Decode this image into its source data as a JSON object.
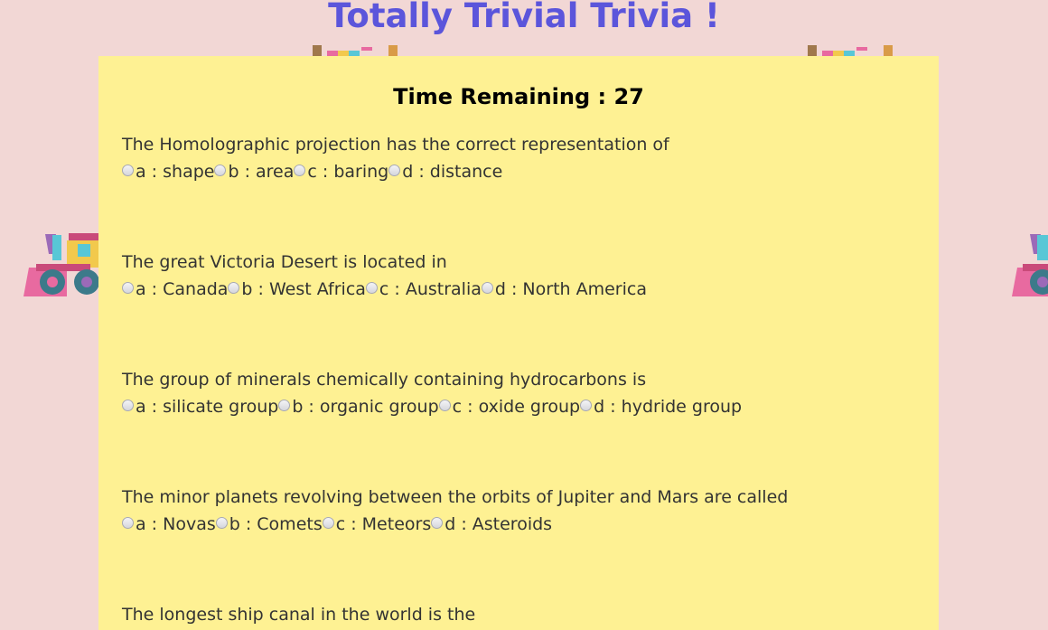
{
  "header": {
    "title": "Totally Trivial Trivia !"
  },
  "timer": {
    "label": "Time Remaining : 27"
  },
  "questions": [
    {
      "text": "The Homolographic projection has the correct representation of",
      "options": [
        "a : shape",
        "b : area",
        "c : baring",
        "d : distance"
      ]
    },
    {
      "text": "The great Victoria Desert is located in",
      "options": [
        "a : Canada",
        "b : West Africa",
        "c : Australia",
        "d : North America"
      ]
    },
    {
      "text": "The group of minerals chemically containing hydrocarbons is",
      "options": [
        "a : silicate group",
        "b : organic group",
        "c : oxide group",
        "d : hydride group"
      ]
    },
    {
      "text": "The minor planets revolving between the orbits of Jupiter and Mars are called",
      "options": [
        "a : Novas",
        "b : Comets",
        "c : Meteors",
        "d : Asteroids"
      ]
    },
    {
      "text": "The longest ship canal in the world is the",
      "options": []
    }
  ],
  "colors": {
    "background": "#f2d7d5",
    "card": "#fef193",
    "title": "#5b55db"
  },
  "decorations": [
    "toy-train-icon",
    "toy-train-icon",
    "toy-train-icon",
    "toy-train-icon"
  ]
}
